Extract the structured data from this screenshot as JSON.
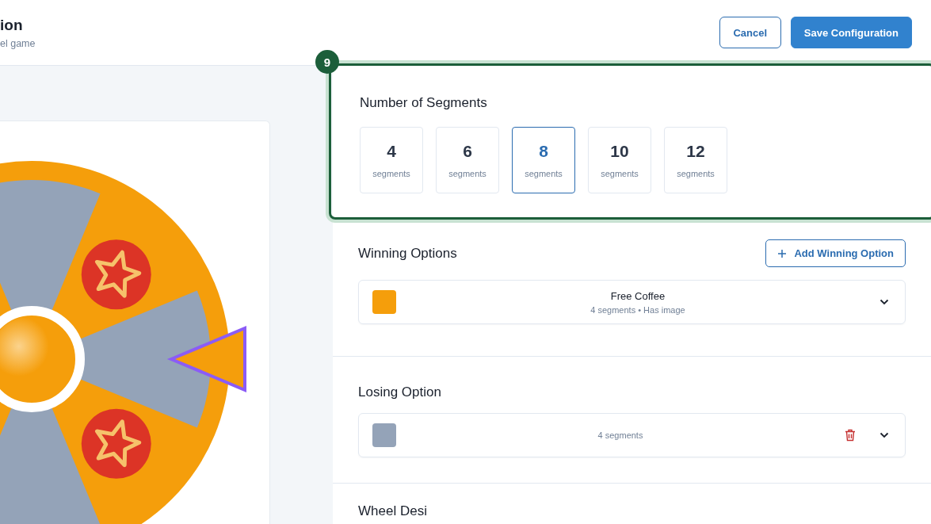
{
  "header": {
    "title": "ion",
    "subtitle": "el game",
    "buttons": [
      {
        "label": "Cancel",
        "kind": "secondary"
      },
      {
        "label": "Save Configuration",
        "kind": "primary"
      }
    ]
  },
  "annotation": {
    "label": "9"
  },
  "segments": {
    "title": "Number of Segments",
    "options": [
      {
        "value": "4",
        "unit": "segments",
        "selected": false
      },
      {
        "value": "6",
        "unit": "segments",
        "selected": false
      },
      {
        "value": "8",
        "unit": "segments",
        "selected": true
      },
      {
        "value": "10",
        "unit": "segments",
        "selected": false
      },
      {
        "value": "12",
        "unit": "segments",
        "selected": false
      }
    ]
  },
  "winning": {
    "title": "Winning Options",
    "add_button": "Add Winning Option",
    "options": [
      {
        "name": "Free Coffee",
        "details": "4 segments • Has image",
        "color": "#f59e0b"
      }
    ]
  },
  "losing": {
    "title": "Losing Option",
    "options": [
      {
        "details": "4 segments",
        "color": "#94a3b8"
      }
    ]
  },
  "next_section": {
    "title": "Wheel Desi"
  }
}
